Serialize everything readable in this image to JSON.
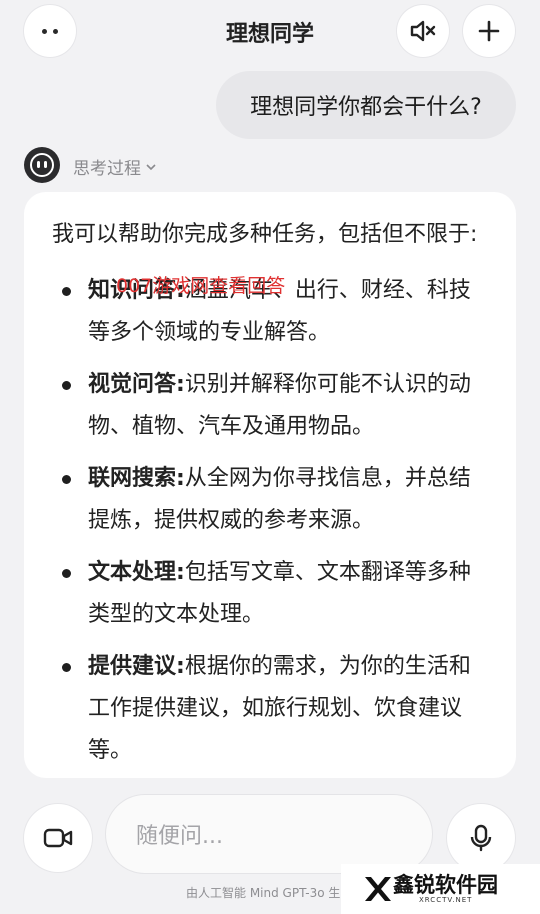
{
  "header": {
    "title": "理想同学",
    "more_icon": "more-dots-icon",
    "mute_icon": "speaker-muted-icon",
    "add_icon": "plus-icon"
  },
  "conversation": {
    "user_message": "理想同学你都会干什么?",
    "thinking_label": "思考过程",
    "answer": {
      "intro": "我可以帮助你完成多种任务，包括但不限于:",
      "items": [
        {
          "title": "知识问答",
          "text": "涵盖汽车、出行、财经、科技等多个领域的专业解答。"
        },
        {
          "title": "视觉问答",
          "text": "识别并解释你可能不认识的动物、植物、汽车及通用物品。"
        },
        {
          "title": "联网搜索",
          "text": "从全网为你寻找信息，并总结提炼，提供权威的参考来源。"
        },
        {
          "title": "文本处理",
          "text": "包括写文章、文本翻译等多种类型的文本处理。"
        },
        {
          "title": "提供建议",
          "text": "根据你的需求，为你的生活和工作提供建议，如旅行规划、饮食建议等。"
        }
      ],
      "colon": ":"
    }
  },
  "overlay": {
    "watermark_text": "007游戏网查看回答",
    "watermark_color": "#e03131"
  },
  "input": {
    "placeholder": "随便问...",
    "video_icon": "video-camera-icon",
    "mic_icon": "microphone-icon"
  },
  "footer": {
    "note": "由人工智能 Mind GPT-3o 生"
  },
  "logo": {
    "name": "鑫锐软件园",
    "domain": "XRCCTV.NET"
  }
}
